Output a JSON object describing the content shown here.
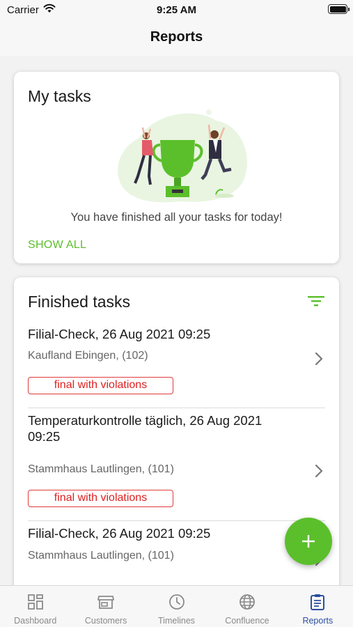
{
  "status_bar": {
    "carrier": "Carrier",
    "time": "9:25 AM"
  },
  "header": {
    "title": "Reports"
  },
  "my_tasks": {
    "title": "My tasks",
    "empty_message": "You have finished all your tasks for today!",
    "show_all_label": "SHOW ALL",
    "illustration": "trophy-celebration-illustration"
  },
  "finished_tasks": {
    "title": "Finished tasks",
    "items": [
      {
        "title": "Filial-Check, 26 Aug 2021 09:25",
        "subtitle": "Kaufland Ebingen, (102)",
        "status": "final with violations"
      },
      {
        "title": "Temperaturkontrolle täglich, 26 Aug 2021 09:25",
        "subtitle": "Stammhaus Lautlingen, (101)",
        "status": "final with violations"
      },
      {
        "title": "Filial-Check, 26 Aug 2021 09:25",
        "subtitle": "Stammhaus Lautlingen, (101)"
      }
    ]
  },
  "fab": {
    "icon": "plus-icon"
  },
  "tabs": [
    {
      "label": "Dashboard",
      "icon": "dashboard-icon"
    },
    {
      "label": "Customers",
      "icon": "store-icon"
    },
    {
      "label": "Timelines",
      "icon": "clock-icon"
    },
    {
      "label": "Confluence",
      "icon": "globe-icon"
    },
    {
      "label": "Reports",
      "icon": "clipboard-icon",
      "active": true
    }
  ],
  "colors": {
    "accent": "#5bbf2b",
    "violation": "#e02020",
    "active_tab": "#2c4f9e"
  }
}
